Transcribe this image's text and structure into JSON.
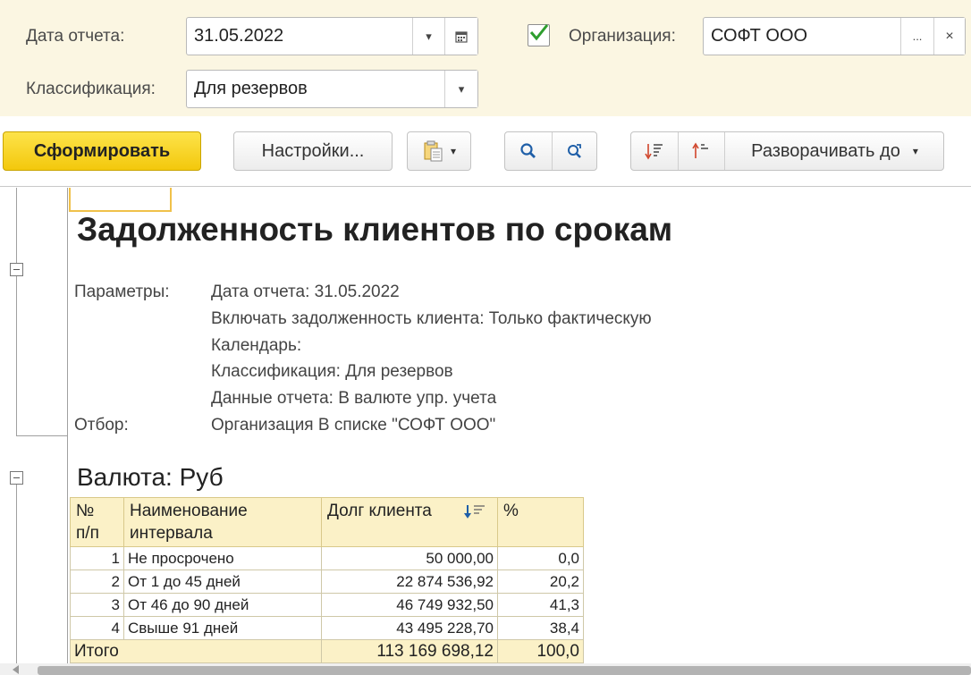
{
  "filters": {
    "date_label": "Дата отчета:",
    "date_value": "31.05.2022",
    "org_label": "Организация:",
    "org_value": "СОФТ ООО",
    "org_select_glyph": "...",
    "org_clear_glyph": "×",
    "classification_label": "Классификация:",
    "classification_value": "Для резервов",
    "org_checked": true
  },
  "toolbar": {
    "generate_label": "Сформировать",
    "settings_label": "Настройки...",
    "expand_label": "Разворачивать до"
  },
  "report": {
    "title": "Задолженность клиентов по срокам",
    "params_label": "Параметры:",
    "params": [
      "Дата отчета: 31.05.2022",
      "Включать задолженность клиента: Только фактическую",
      "Календарь:",
      "Классификация: Для резервов",
      "Данные отчета: В валюте упр. учета"
    ],
    "filter_label": "Отбор:",
    "filter_value": "Организация В списке \"СОФТ ООО\"",
    "section_title": "Валюта: Руб",
    "table": {
      "headers": {
        "num_line1": "№",
        "num_line2": "п/п",
        "name_line1": "Наименование",
        "name_line2": "интервала",
        "debt": "Долг клиента",
        "percent": "%"
      },
      "rows": [
        {
          "num": "1",
          "name": "Не просрочено",
          "debt": "50 000,00",
          "percent": "0,0"
        },
        {
          "num": "2",
          "name": "От 1 до 45 дней",
          "debt": "22 874 536,92",
          "percent": "20,2"
        },
        {
          "num": "3",
          "name": "От 46 до 90 дней",
          "debt": "46 749 932,50",
          "percent": "41,3"
        },
        {
          "num": "4",
          "name": "Свыше 91 дней",
          "debt": "43 495 228,70",
          "percent": "38,4"
        }
      ],
      "total": {
        "label": "Итого",
        "debt": "113 169 698,12",
        "percent": "100,0"
      }
    }
  },
  "colors": {
    "filter_bg": "#fbf6e2",
    "primary_button": "#f3c80c",
    "table_header_bg": "#fbf1c7",
    "check_mark": "#2e9e2e"
  },
  "icons": [
    "dropdown-arrow-icon",
    "calendar-icon",
    "checkmark-icon",
    "clipboard-icon",
    "search-icon",
    "refresh-search-icon",
    "sort-descending-icon",
    "sort-ascending-icon",
    "collapse-icon"
  ]
}
